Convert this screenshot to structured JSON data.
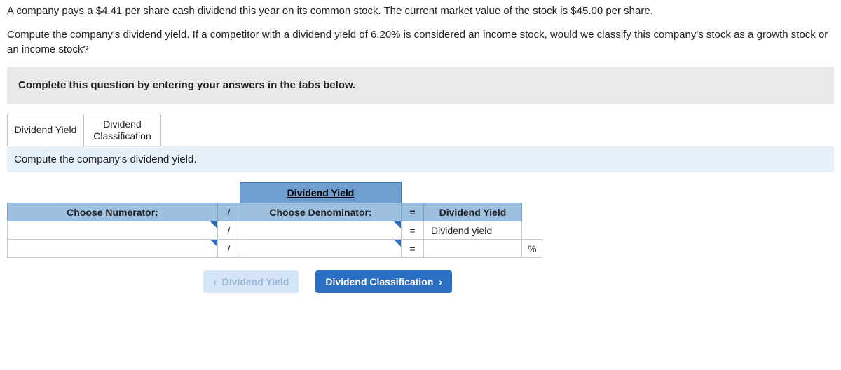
{
  "prompt": {
    "p1": "A company pays a $4.41 per share cash dividend this year on its common stock. The current market value of the stock is $45.00 per share.",
    "p2": "Compute the company's dividend yield. If a competitor with a dividend yield of 6.20% is considered an income stock, would we classify this company's stock as a growth stock or an income stock?"
  },
  "instruction": "Complete this question by entering your answers in the tabs below.",
  "tabs": {
    "t1": "Dividend Yield",
    "t2a": "Dividend",
    "t2b": "Classification"
  },
  "subheading": "Compute the company's dividend yield.",
  "table": {
    "title": "Dividend Yield",
    "choose_num": "Choose Numerator:",
    "choose_den": "Choose Denominator:",
    "result_hdr": "Dividend Yield",
    "slash": "/",
    "eq": "=",
    "result_label": "Dividend yield",
    "pct": "%"
  },
  "nav": {
    "prev": "Dividend Yield",
    "next": "Dividend Classification"
  }
}
